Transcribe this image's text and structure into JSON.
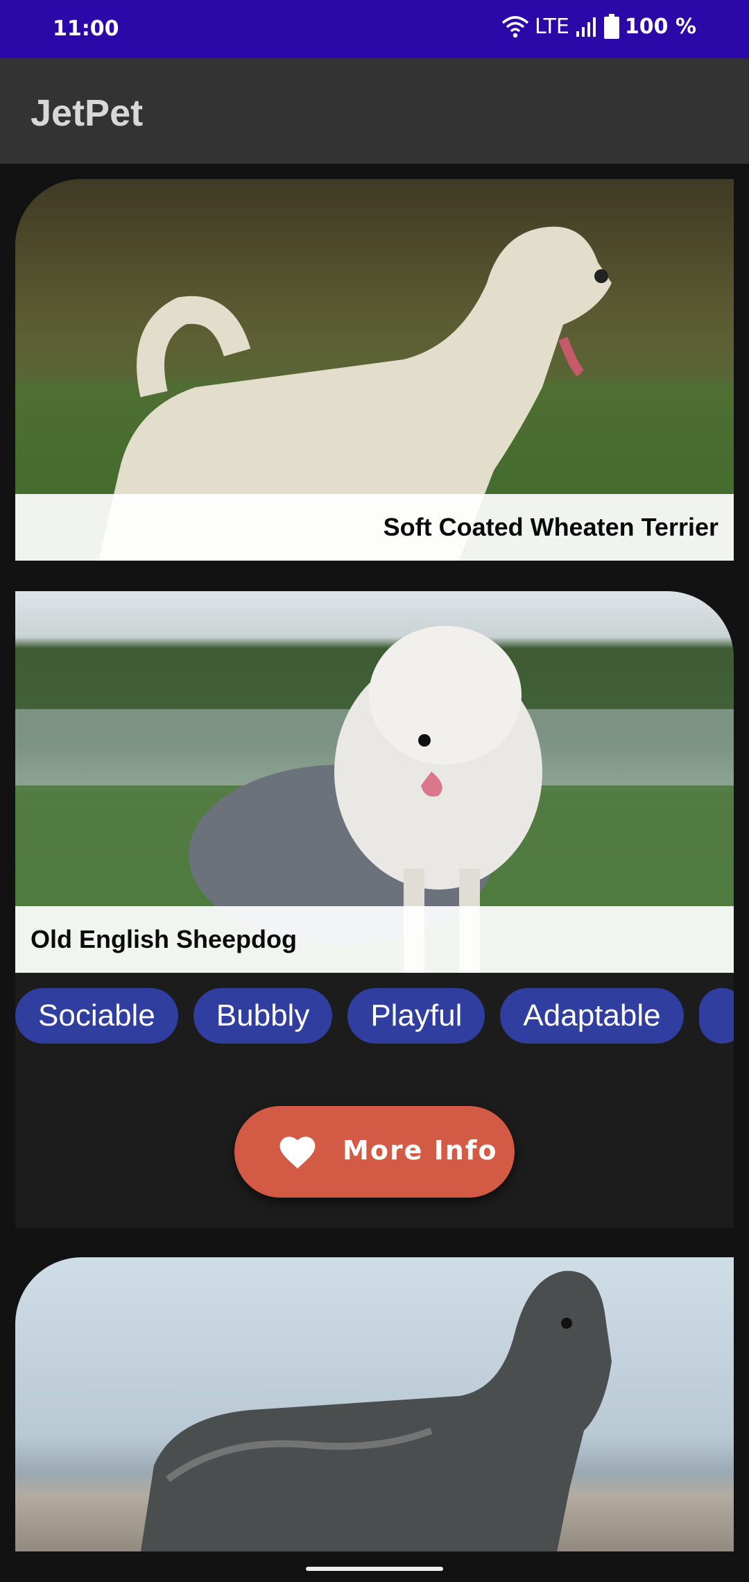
{
  "status_bar": {
    "time": "11:00",
    "network": "LTE",
    "battery": "100 %",
    "icons": [
      "wifi-icon",
      "signal-icon",
      "battery-icon"
    ]
  },
  "app_bar": {
    "title": "JetPet"
  },
  "cards": [
    {
      "breed": "Soft Coated Wheaten Terrier"
    },
    {
      "breed": "Old English Sheepdog",
      "tags": [
        "Sociable",
        "Bubbly",
        "Playful",
        "Adaptable",
        ""
      ],
      "button": {
        "label": "More Info",
        "icon": "heart-icon"
      }
    },
    {
      "breed": ""
    }
  ],
  "colors": {
    "status_bar": "#2a09a8",
    "app_bar": "#333333",
    "chip": "#303f9f",
    "button": "#d35b45",
    "background": "#121212"
  }
}
